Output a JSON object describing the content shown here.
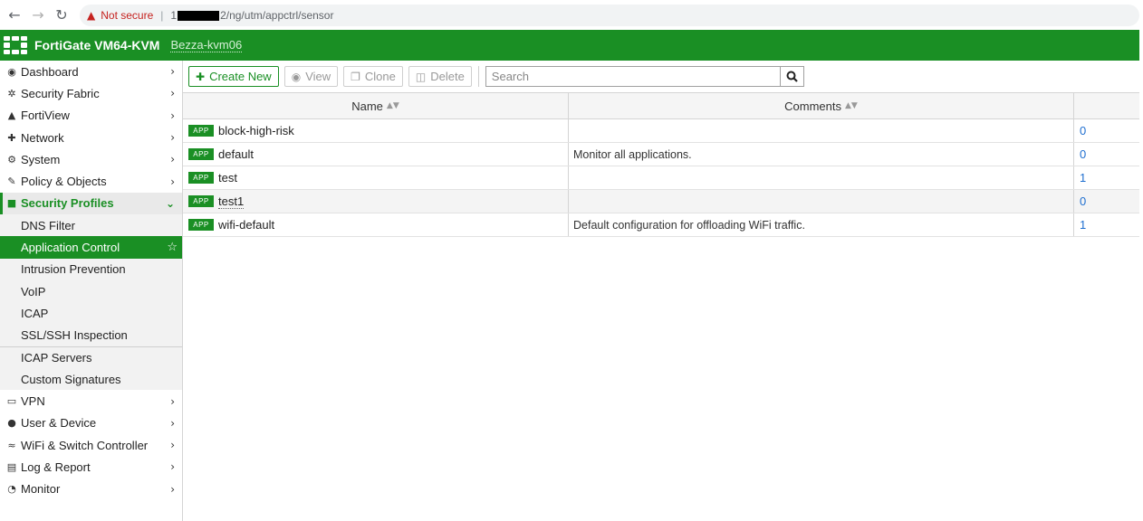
{
  "browser": {
    "warning_icon": "warning-triangle-icon",
    "not_secure": "Not secure",
    "url_prefix": "1",
    "url_suffix": "2/ng/utm/appctrl/sensor"
  },
  "header": {
    "product": "FortiGate VM64-KVM",
    "hostname": "Bezza-kvm06",
    "accent": "#1a8f24"
  },
  "sidebar": {
    "items_top": [
      {
        "label": "Dashboard",
        "icon": "dashboard-icon"
      },
      {
        "label": "Security Fabric",
        "icon": "security-fabric-icon"
      },
      {
        "label": "FortiView",
        "icon": "fortiview-icon"
      },
      {
        "label": "Network",
        "icon": "network-icon"
      },
      {
        "label": "System",
        "icon": "gear-icon"
      },
      {
        "label": "Policy & Objects",
        "icon": "policy-icon"
      }
    ],
    "open_section": {
      "label": "Security Profiles",
      "icon": "lock-icon"
    },
    "sub_items": [
      "DNS Filter",
      "Application Control",
      "Intrusion Prevention",
      "VoIP",
      "ICAP",
      "SSL/SSH Inspection",
      "ICAP Servers",
      "Custom Signatures"
    ],
    "items_bottom": [
      {
        "label": "VPN",
        "icon": "laptop-icon"
      },
      {
        "label": "User & Device",
        "icon": "user-icon"
      },
      {
        "label": "WiFi & Switch Controller",
        "icon": "wifi-icon"
      },
      {
        "label": "Log & Report",
        "icon": "bar-chart-icon"
      },
      {
        "label": "Monitor",
        "icon": "monitor-icon"
      }
    ]
  },
  "toolbar": {
    "create_new": "Create New",
    "view": "View",
    "clone": "Clone",
    "delete": "Delete",
    "search_placeholder": "Search"
  },
  "table": {
    "headers": {
      "name": "Name",
      "comments": "Comments"
    },
    "badge": "APP",
    "rows": [
      {
        "name": "block-high-risk",
        "comment": "",
        "ref": "0"
      },
      {
        "name": "default",
        "comment": "Monitor all applications.",
        "ref": "0"
      },
      {
        "name": "test",
        "comment": "",
        "ref": "1"
      },
      {
        "name": "test1",
        "comment": "",
        "ref": "0"
      },
      {
        "name": "wifi-default",
        "comment": "Default configuration for offloading WiFi traffic.",
        "ref": "1"
      }
    ]
  }
}
